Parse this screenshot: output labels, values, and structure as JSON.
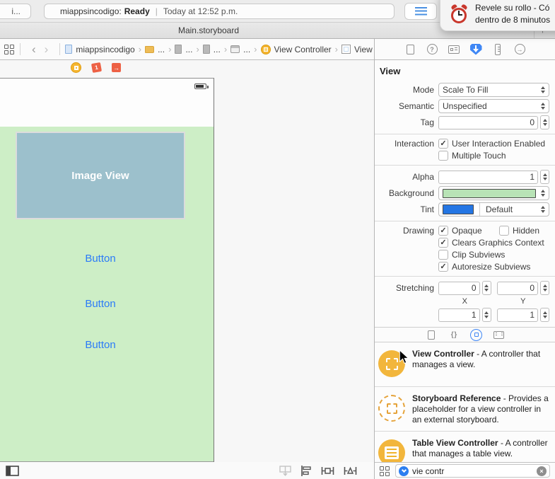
{
  "colors": {
    "accent_blue": "#3f87f5",
    "canvas_view_green": "#cdeec6",
    "image_view_blue": "#9cc0cc",
    "button_text_blue": "#2b7bf8",
    "background_well_green": "#b8e3b6",
    "tint_well_blue": "#2476e4",
    "library_icon_yellow": "#f2b63c"
  },
  "toolbar": {
    "scheme_label": "i...",
    "status_project": "miappsincodigo:",
    "status_state": "Ready",
    "status_divider": "|",
    "status_time": "Today at 12:52 p.m."
  },
  "notification": {
    "title_line": "Revele su rollo - Có",
    "subtitle_line": "dentro de 8 minutos"
  },
  "tabbar": {
    "title": "Main.storyboard",
    "add_glyph": "+"
  },
  "jumpbar": {
    "back_glyph": "‹",
    "forward_glyph": "›",
    "separator": "›",
    "crumbs": [
      {
        "label": "miappsincodigo"
      },
      {
        "label": "..."
      },
      {
        "label": "..."
      },
      {
        "label": "..."
      },
      {
        "label": "..."
      },
      {
        "label": "View Controller"
      },
      {
        "label": "View"
      }
    ]
  },
  "scene_dock": {
    "first_responder_glyph": "1",
    "exit_glyph": "→"
  },
  "canvas": {
    "image_view_label": "Image View",
    "button_labels": [
      "Button",
      "Button",
      "Button"
    ]
  },
  "inspector": {
    "title": "View",
    "help_glyph": "?",
    "connections_glyph": "→",
    "mode": {
      "label": "Mode",
      "value": "Scale To Fill"
    },
    "semantic": {
      "label": "Semantic",
      "value": "Unspecified"
    },
    "tag": {
      "label": "Tag",
      "value": "0"
    },
    "interaction": {
      "label": "Interaction",
      "user_interaction": {
        "label": "User Interaction Enabled",
        "mark": "✓"
      },
      "multiple_touch": {
        "label": "Multiple Touch",
        "mark": ""
      }
    },
    "alpha": {
      "label": "Alpha",
      "value": "1"
    },
    "background": {
      "label": "Background"
    },
    "tint": {
      "label": "Tint",
      "value": "Default"
    },
    "drawing": {
      "label": "Drawing",
      "opaque": {
        "label": "Opaque",
        "mark": "✓"
      },
      "hidden": {
        "label": "Hidden",
        "mark": ""
      },
      "clears": {
        "label": "Clears Graphics Context",
        "mark": "✓"
      },
      "clip": {
        "label": "Clip Subviews",
        "mark": ""
      },
      "autoresize": {
        "label": "Autoresize Subviews",
        "mark": "✓"
      }
    },
    "stretching": {
      "label": "Stretching",
      "x_value": "0",
      "y_value": "0",
      "x_label": "X",
      "y_label": "Y",
      "width_value": "1",
      "height_value": "1"
    }
  },
  "library": {
    "snippets_glyph": "{ }",
    "items": [
      {
        "name": "View Controller",
        "description": "- A controller that manages a view."
      },
      {
        "name": "Storyboard Reference",
        "description": "- Provides a placeholder for a view controller in an external storyboard."
      },
      {
        "name": "Table View Controller",
        "description": "- A controller that manages a table view."
      }
    ],
    "search_value": "vie contr",
    "clear_glyph": "×"
  }
}
